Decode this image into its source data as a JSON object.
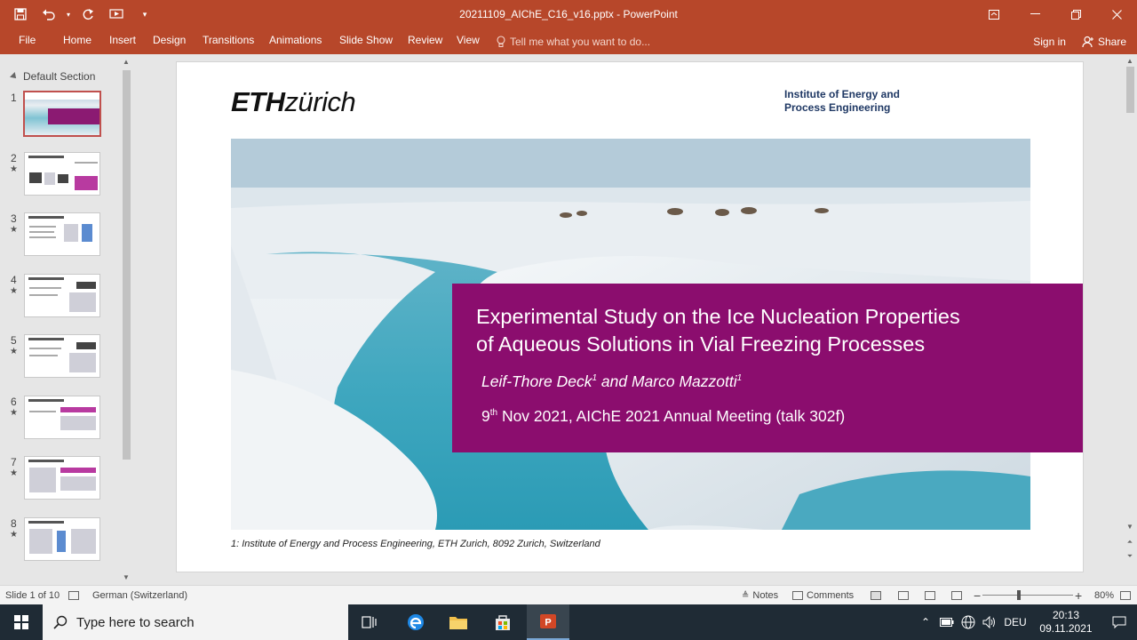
{
  "window": {
    "title": "20211109_AIChE_C16_v16.pptx - PowerPoint"
  },
  "qat": {
    "save_icon": "save-icon",
    "undo_icon": "undo-icon",
    "redo_icon": "redo-icon"
  },
  "ribbon": {
    "tabs": [
      "File",
      "Home",
      "Insert",
      "Design",
      "Transitions",
      "Animations",
      "Slide Show",
      "Review",
      "View"
    ],
    "tell_me": "Tell me what you want to do...",
    "sign_in": "Sign in",
    "share": "Share"
  },
  "sections": {
    "default": "Default Section"
  },
  "thumbnails": [
    {
      "num": "1"
    },
    {
      "num": "2"
    },
    {
      "num": "3"
    },
    {
      "num": "4"
    },
    {
      "num": "5"
    },
    {
      "num": "6"
    },
    {
      "num": "7"
    },
    {
      "num": "8"
    }
  ],
  "slide": {
    "logo_bold": "ETH",
    "logo_rest": "zürich",
    "institute": "Institute of Energy and\nProcess Engineering",
    "title": "Experimental Study on the Ice Nucleation Properties\nof Aqueous Solutions in Vial Freezing Processes",
    "author1": "Leif-Thore Deck",
    "author1_sup": "1",
    "author_and": " and Marco Mazzotti",
    "author2_sup": "1",
    "date_day": "9",
    "date_sup": "th",
    "date_rest": " Nov 2021, AIChE 2021 Annual Meeting (talk 302f)",
    "footnote": "1: Institute of Energy and Process Engineering, ETH Zurich, 8092 Zurich, Switzerland"
  },
  "status": {
    "slide_count": "Slide 1 of 10",
    "language": "German (Switzerland)",
    "notes": "Notes",
    "comments": "Comments",
    "zoom": "80%"
  },
  "taskbar": {
    "search_placeholder": "Type here to search",
    "lang": "DEU",
    "time": "20:13",
    "date": "09.11.2021"
  }
}
